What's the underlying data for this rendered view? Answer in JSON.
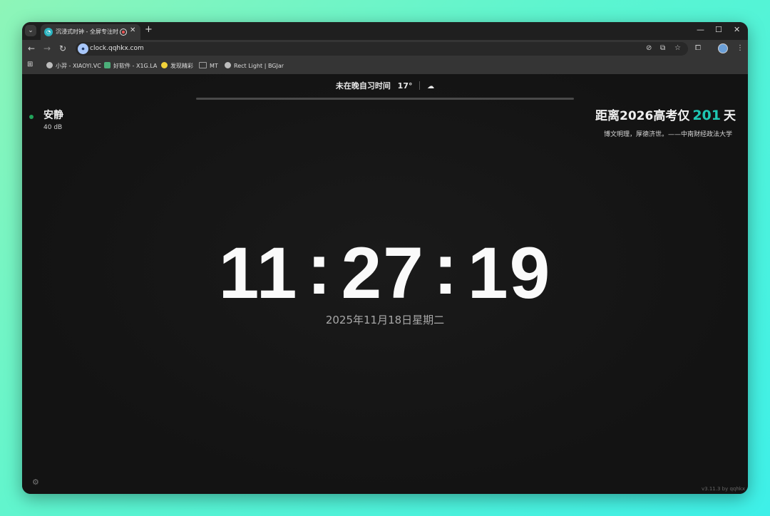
{
  "tab": {
    "title": "沉浸式时钟 - 全屏专注时钟",
    "favicon": "clock-favicon-icon",
    "recording_icon": "recording-icon",
    "close_glyph": "✕",
    "new_tab_glyph": "+"
  },
  "toolbar": {
    "url": "clock.qqhkx.com"
  },
  "bookmarks": [
    {
      "label": "小羿 - XIAOYI.VC",
      "icon_color": "#bdbdbd"
    },
    {
      "label": "好软件 - X1G.LA",
      "icon_color": "#4caf7a"
    },
    {
      "label": "发现精彩",
      "icon_color": "#f2d33a"
    },
    {
      "label": "MT",
      "icon_color": "#9e9e9e"
    },
    {
      "label": "Rect Light | BGJar",
      "icon_color": "#bdbdbd"
    }
  ],
  "status": {
    "text": "未在晚自习时间",
    "temperature": "17°",
    "weather_icon": "cloud-icon"
  },
  "noise": {
    "label": "安静",
    "level": "40 dB",
    "status_color": "#22a35a"
  },
  "countdown": {
    "prefix": "距离2026高考仅",
    "days": "201",
    "suffix": "天",
    "accent_color": "#1fc7b4"
  },
  "motto": "博文明理，厚德济世。——中南财经政法大学",
  "clock": {
    "hours": "11",
    "minutes": "27",
    "seconds": "19",
    "colon": ":"
  },
  "date": "2025年11月18日星期二",
  "footer": {
    "version": "v3.11.3  by qqhkx"
  }
}
